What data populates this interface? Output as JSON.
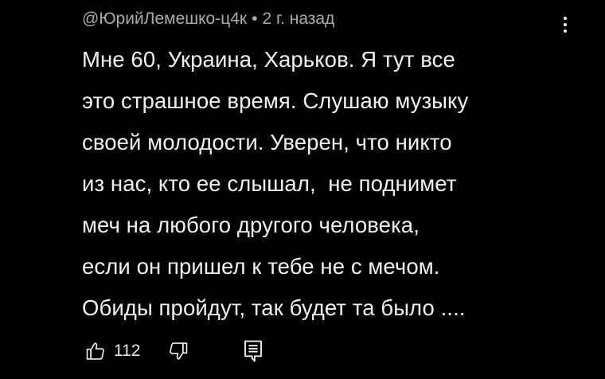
{
  "comment": {
    "author": "@ЮрийЛемешко-ц4к",
    "separator": "•",
    "time": "2 г. назад",
    "text_lines": [
      "Мне 60, Украина, Харьков. Я тут все",
      "это страшное время. Слушаю музыку",
      "своей молодости. Уверен, что никто",
      "из нас, кто ее слышал,  не поднимет",
      "меч на любого другого человека,",
      "если он пришел к тебе не с мечом.",
      "Обиды пройдут, так будет та было ...."
    ],
    "like_count": "112",
    "icons": {
      "like": "thumb-up-icon",
      "dislike": "thumb-down-icon",
      "reply": "reply-comment-icon",
      "menu": "more-vertical-icon"
    }
  },
  "colors": {
    "background": "#000000",
    "text": "#f1f1f1",
    "meta": "#aaaaaa"
  }
}
